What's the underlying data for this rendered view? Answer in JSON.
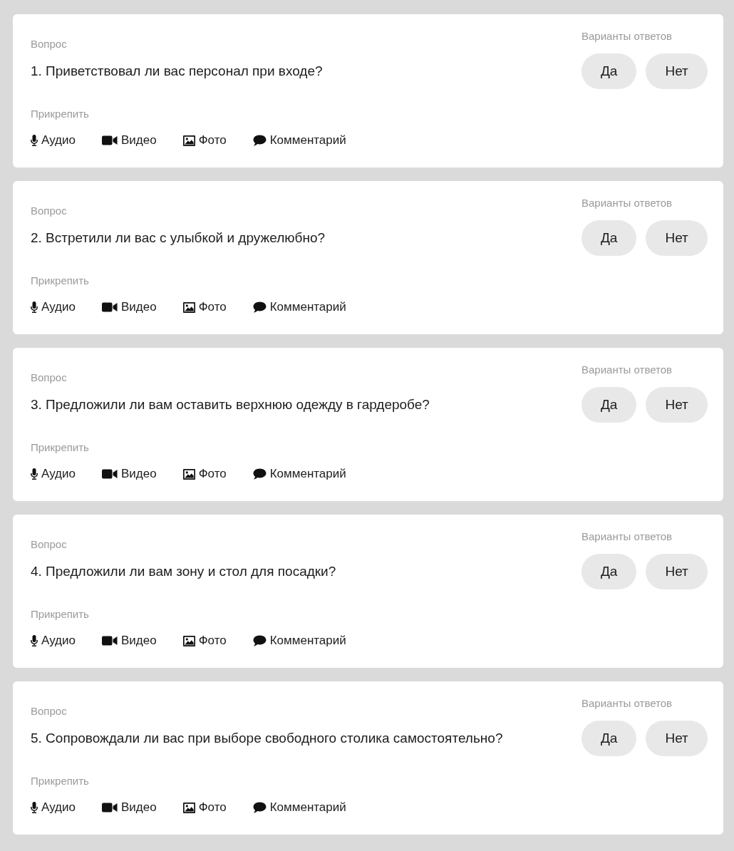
{
  "questions": [
    {
      "label": "Вопрос",
      "text": "1. Приветствовал ли вас персонал при входе?",
      "attach_label": "Прикрепить",
      "attachments": [
        {
          "kind": "audio",
          "label": "Аудио"
        },
        {
          "kind": "video",
          "label": "Видео"
        },
        {
          "kind": "photo",
          "label": "Фото"
        },
        {
          "kind": "comment",
          "label": "Комментарий"
        }
      ],
      "answers_label": "Варианты ответов",
      "answers": [
        {
          "label": "Да",
          "selected": false
        },
        {
          "label": "Нет",
          "selected": false
        }
      ]
    },
    {
      "label": "Вопрос",
      "text": "2. Встретили ли вас с улыбкой и дружелюбно?",
      "attach_label": "Прикрепить",
      "attachments": [
        {
          "kind": "audio",
          "label": "Аудио"
        },
        {
          "kind": "video",
          "label": "Видео"
        },
        {
          "kind": "photo",
          "label": "Фото"
        },
        {
          "kind": "comment",
          "label": "Комментарий"
        }
      ],
      "answers_label": "Варианты ответов",
      "answers": [
        {
          "label": "Да",
          "selected": false
        },
        {
          "label": "Нет",
          "selected": false
        }
      ]
    },
    {
      "label": "Вопрос",
      "text": "3. Предложили ли вам оставить верхнюю одежду в гардеробе?",
      "attach_label": "Прикрепить",
      "attachments": [
        {
          "kind": "audio",
          "label": "Аудио"
        },
        {
          "kind": "video",
          "label": "Видео"
        },
        {
          "kind": "photo",
          "label": "Фото"
        },
        {
          "kind": "comment",
          "label": "Комментарий"
        }
      ],
      "answers_label": "Варианты ответов",
      "answers": [
        {
          "label": "Да",
          "selected": false
        },
        {
          "label": "Нет",
          "selected": false
        }
      ]
    },
    {
      "label": "Вопрос",
      "text": "4. Предложили ли вам зону и стол для посадки?",
      "attach_label": "Прикрепить",
      "attachments": [
        {
          "kind": "audio",
          "label": "Аудио"
        },
        {
          "kind": "video",
          "label": "Видео"
        },
        {
          "kind": "photo",
          "label": "Фото"
        },
        {
          "kind": "comment",
          "label": "Комментарий"
        }
      ],
      "answers_label": "Варианты ответов",
      "answers": [
        {
          "label": "Да",
          "selected": false
        },
        {
          "label": "Нет",
          "selected": false
        }
      ]
    },
    {
      "label": "Вопрос",
      "text": "5. Сопровождали ли вас при выборе свободного столика самостоятельно?",
      "attach_label": "Прикрепить",
      "attachments": [
        {
          "kind": "audio",
          "label": "Аудио"
        },
        {
          "kind": "video",
          "label": "Видео"
        },
        {
          "kind": "photo",
          "label": "Фото"
        },
        {
          "kind": "comment",
          "label": "Комментарий"
        }
      ],
      "answers_label": "Варианты ответов",
      "answers": [
        {
          "label": "Да",
          "selected": false
        },
        {
          "label": "Нет",
          "selected": false
        }
      ]
    }
  ]
}
